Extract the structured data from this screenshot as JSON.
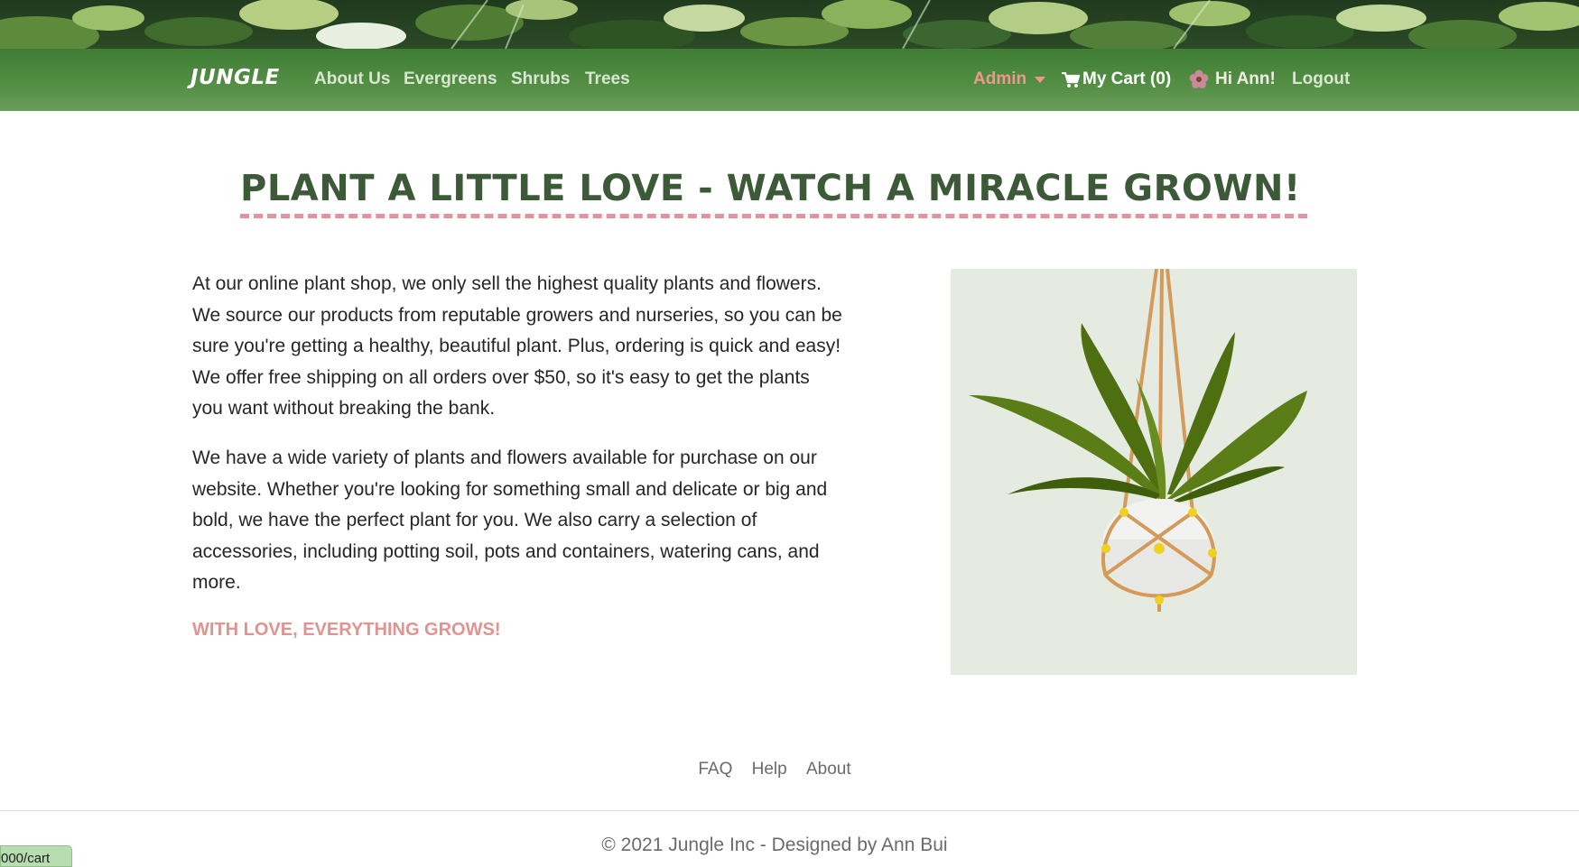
{
  "navbar": {
    "brand": "JUNGLE",
    "links": [
      "About Us",
      "Evergreens",
      "Shrubs",
      "Trees"
    ],
    "admin_label": "Admin",
    "cart_label": "My Cart (0)",
    "greeting": "Hi Ann!",
    "logout_label": "Logout"
  },
  "main": {
    "headline": "PLANT A LITTLE LOVE - WATCH A MIRACLE GROWN!",
    "paragraph1": "At our online plant shop, we only sell the highest quality plants and flowers. We source our products from reputable growers and nurseries, so you can be sure you're getting a healthy, beautiful plant. Plus, ordering is quick and easy! We offer free shipping on all orders over $50, so it's easy to get the plants you want without breaking the bank.",
    "paragraph2": "We have a wide variety of plants and flowers available for purchase on our website. Whether you're looking for something small and delicate or big and bold, we have the perfect plant for you. We also carry a selection of accessories, including potting soil, pots and containers, watering cans, and more.",
    "tagline": "WITH LOVE, EVERYTHING GROWS!"
  },
  "footer": {
    "links": [
      "FAQ",
      "Help",
      "About"
    ],
    "copyright": "© 2021 Jungle Inc - Designed by Ann Bui"
  },
  "status_bar": {
    "url": "000/cart"
  },
  "colors": {
    "navbar_green": "#4a8a3e",
    "accent_pink": "#e09391",
    "headline_green": "#3c5a38"
  },
  "icons": [
    "cart-icon",
    "flower-icon",
    "caret-down-icon"
  ]
}
